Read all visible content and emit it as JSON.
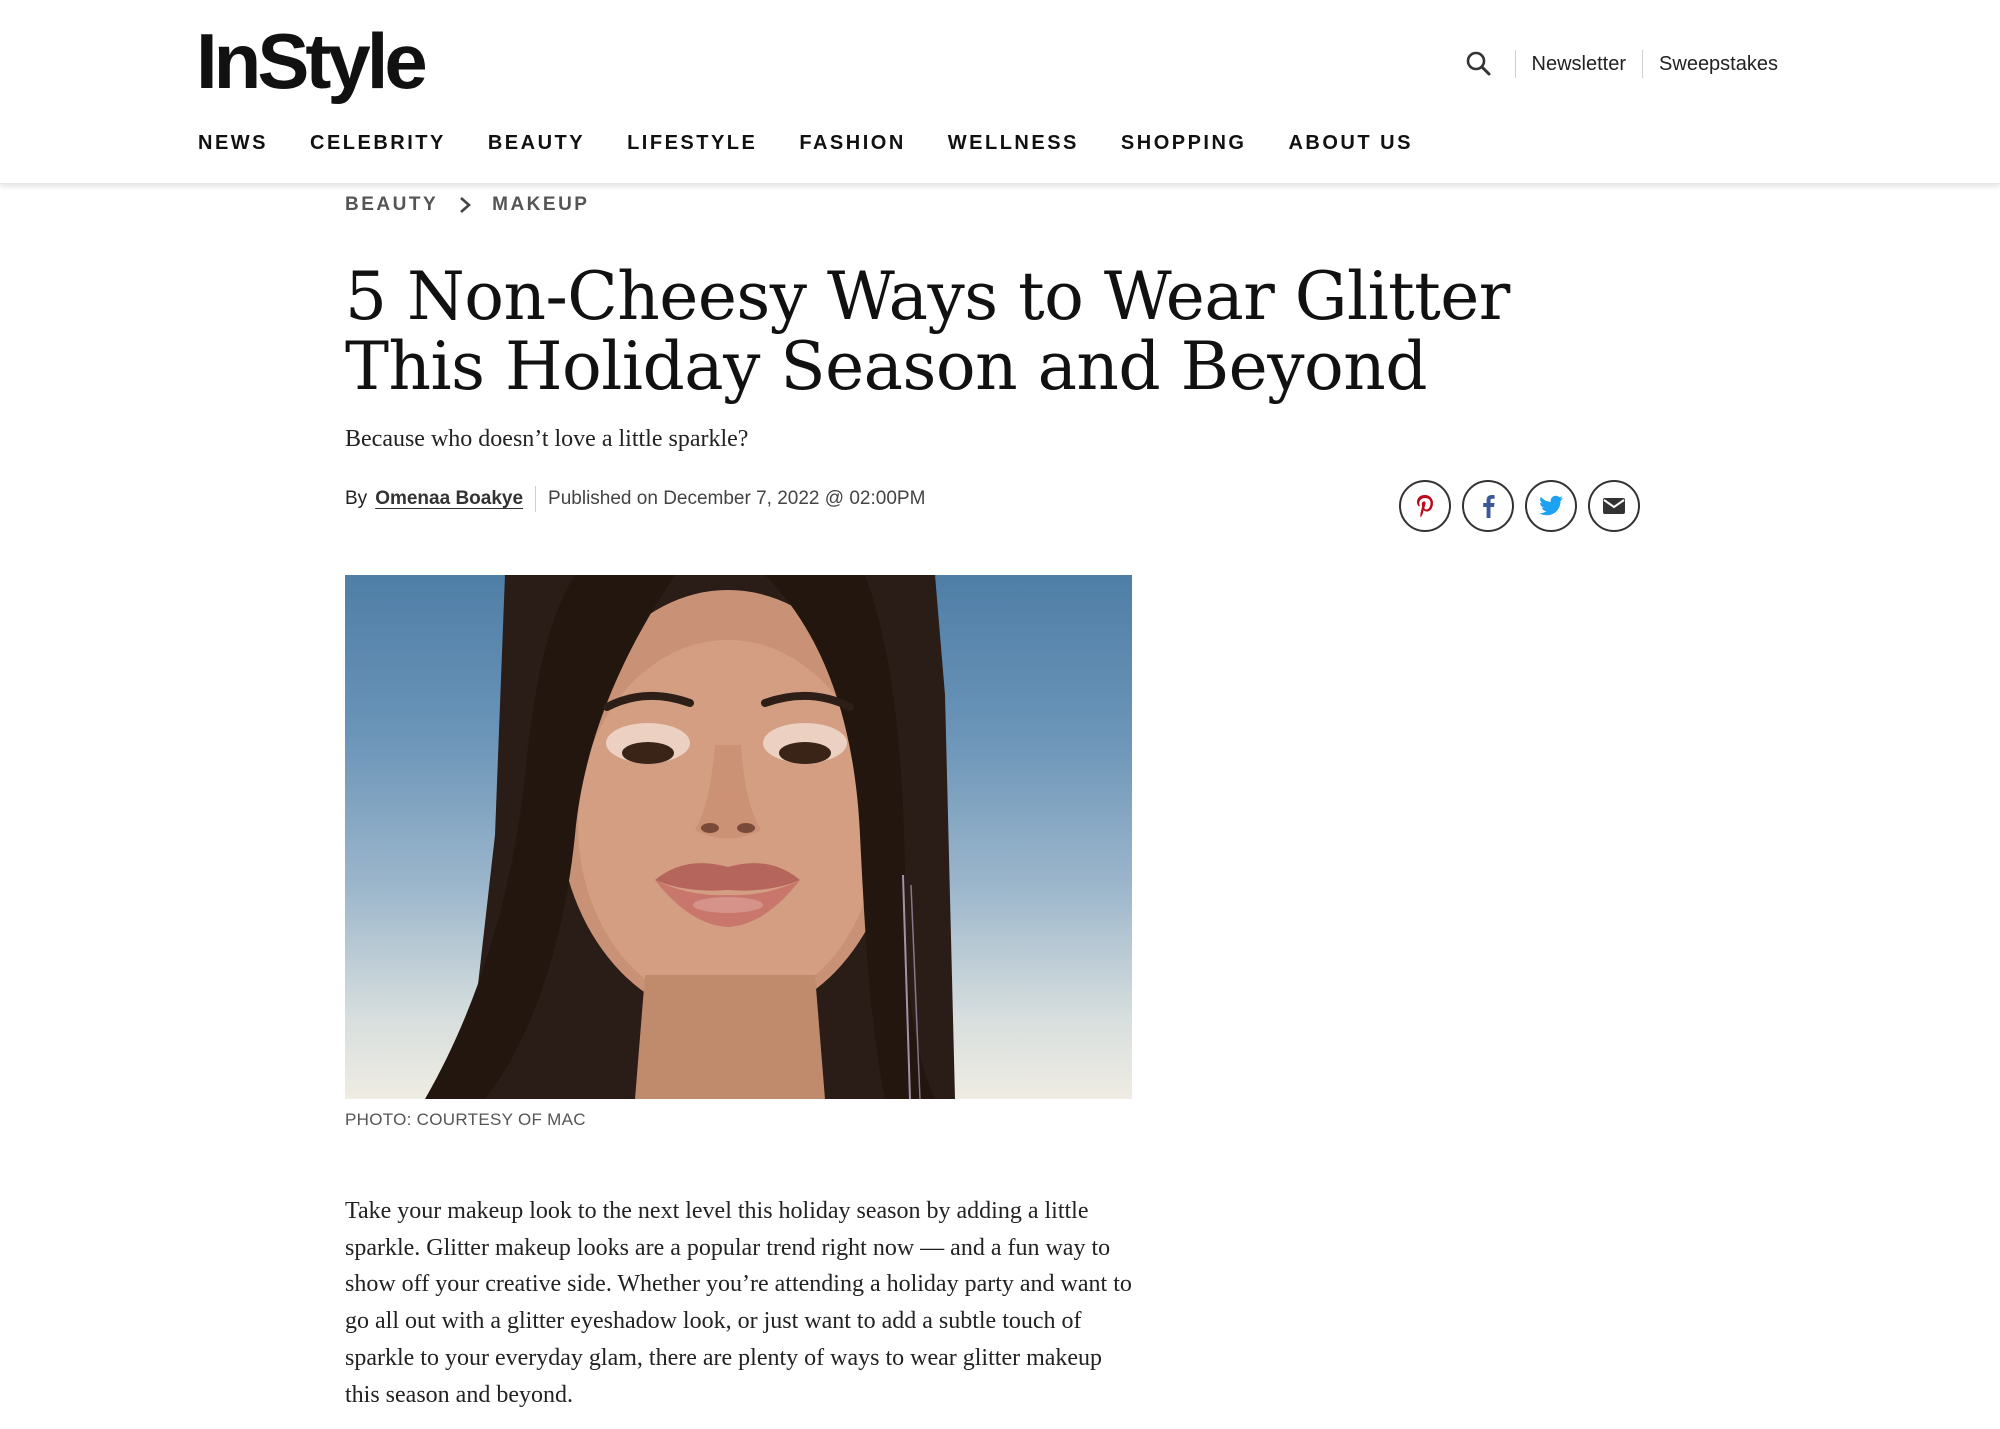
{
  "header": {
    "logo": "InStyle",
    "util_links": [
      "Newsletter",
      "Sweepstakes"
    ],
    "nav": [
      "NEWS",
      "CELEBRITY",
      "BEAUTY",
      "LIFESTYLE",
      "FASHION",
      "WELLNESS",
      "SHOPPING",
      "ABOUT US"
    ]
  },
  "breadcrumb": [
    "BEAUTY",
    "MAKEUP"
  ],
  "article": {
    "title": "5 Non-Cheesy Ways to Wear Glitter This Holiday Season and Beyond",
    "dek": "Because who doesn’t love a little sparkle?",
    "by_label": "By",
    "author": "Omenaa Boakye",
    "published": "Published on December 7, 2022 @ 02:00PM",
    "image_caption": "PHOTO: COURTESY OF MAC",
    "body": "Take your makeup look to the next level this holiday season by adding a little sparkle. Glitter makeup looks are a popular trend right now — and a fun way to show off your creative side. Whether you’re attending a holiday party and want to go all out with a glitter eyeshadow look, or just want to add a subtle touch of sparkle to your everyday glam, there are plenty of ways to wear glitter makeup this season and beyond."
  },
  "share": {
    "icons": [
      "pinterest-icon",
      "facebook-icon",
      "twitter-icon",
      "email-icon"
    ],
    "colors": {
      "pinterest": "#bd081c",
      "facebook": "#3b5998",
      "twitter": "#1da1f2",
      "email": "#333333"
    }
  }
}
